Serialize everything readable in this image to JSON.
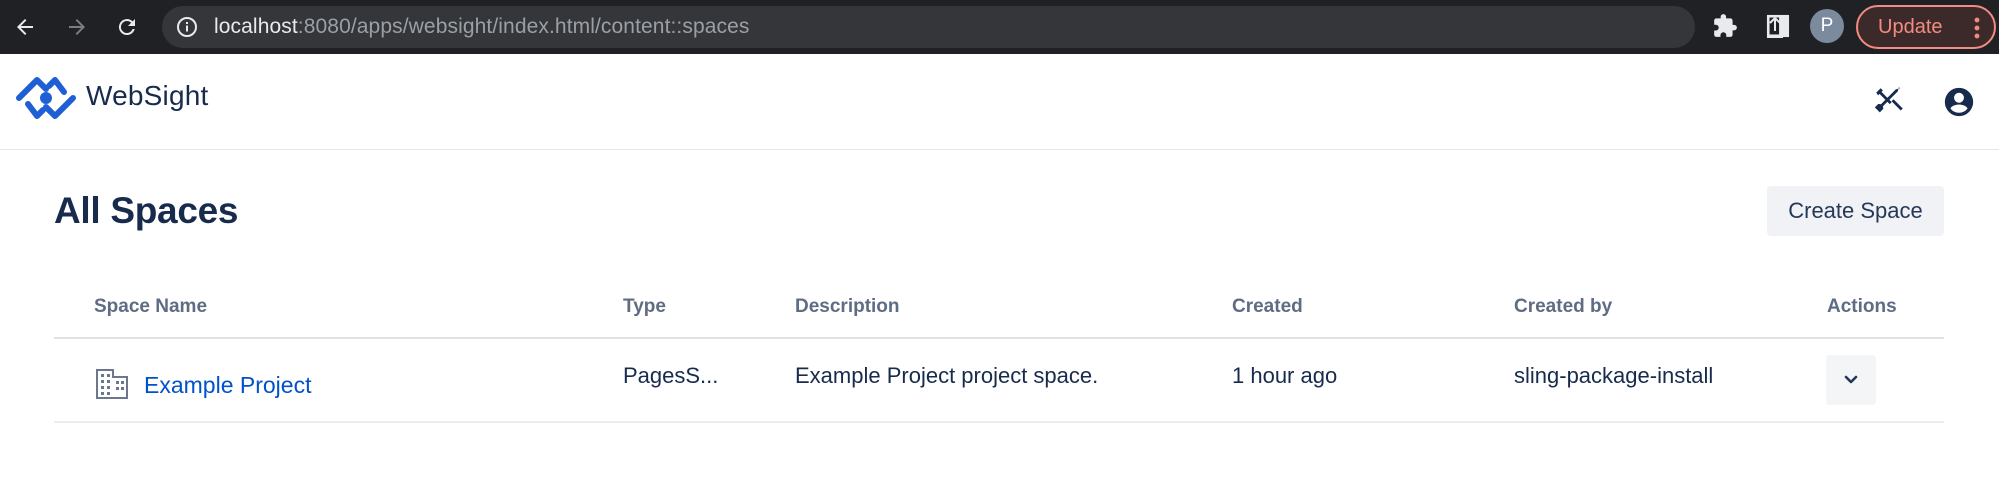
{
  "browser": {
    "url_host": "localhost",
    "url_rest": ":8080/apps/websight/index.html/content::spaces",
    "profile_initial": "P",
    "update_label": "Update",
    "icons": [
      "back-arrow-icon",
      "forward-arrow-icon",
      "reload-icon",
      "info-icon",
      "share-icon",
      "star-icon",
      "puzzle-icon",
      "side-panel-icon",
      "more-vert-icon"
    ]
  },
  "header": {
    "brand": "WebSight",
    "icons": [
      "websight-logo-icon",
      "tools-icon",
      "account-circle-icon"
    ],
    "brand_color": "#1f5fd6"
  },
  "page": {
    "title": "All Spaces",
    "create_button": "Create Space"
  },
  "table": {
    "columns": [
      "Space Name",
      "Type",
      "Description",
      "Created",
      "Created by",
      "Actions"
    ],
    "rows": [
      {
        "name": "Example Project",
        "type": "PagesS...",
        "description": "Example Project project space.",
        "created": "1 hour ago",
        "created_by": "sling-package-install",
        "icon": "building-icon",
        "action_icon": "chevron-down-icon"
      }
    ]
  }
}
